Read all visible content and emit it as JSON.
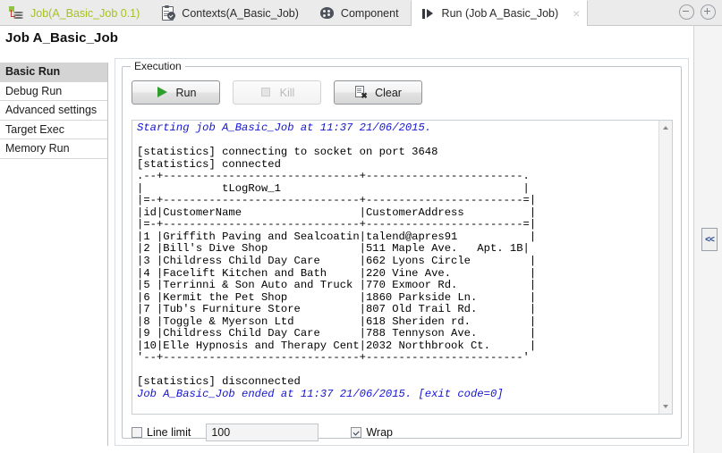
{
  "window": {
    "minimize_icon": "minimize-icon",
    "maximize_icon": "maximize-icon"
  },
  "tabs": [
    {
      "label": "Job(A_Basic_Job 0.1)",
      "icon": "job-icon",
      "active": false
    },
    {
      "label": "Contexts(A_Basic_Job)",
      "icon": "clipboard-check-icon",
      "active": false
    },
    {
      "label": "Component",
      "icon": "palette-icon",
      "active": false
    },
    {
      "label": "Run (Job A_Basic_Job)",
      "icon": "run-step-icon",
      "active": true,
      "close": "×"
    }
  ],
  "page_title": "Job A_Basic_Job",
  "sidebar": {
    "items": [
      {
        "label": "Basic Run",
        "selected": true
      },
      {
        "label": "Debug Run",
        "selected": false
      },
      {
        "label": "Advanced settings",
        "selected": false
      },
      {
        "label": "Target Exec",
        "selected": false
      },
      {
        "label": "Memory Run",
        "selected": false
      }
    ]
  },
  "execution": {
    "group_label": "Execution",
    "buttons": [
      {
        "label": "Run",
        "icon": "play-icon",
        "enabled": true
      },
      {
        "label": "Kill",
        "icon": "stop-icon",
        "enabled": false
      },
      {
        "label": "Clear",
        "icon": "clear-page-icon",
        "enabled": true
      }
    ]
  },
  "console": {
    "start_line": "Starting job A_Basic_Job at 11:37 21/06/2015.",
    "stats_connecting": "[statistics] connecting to socket on port 3648",
    "stats_connected": "[statistics] connected",
    "table_top": ".--+------------------------------+------------------------.",
    "table_title": "|            tLogRow_1                                     |",
    "table_sep1": "|=-+------------------------------+------------------------=|",
    "table_header": "|id|CustomerName                  |CustomerAddress          |",
    "table_sep2": "|=-+------------------------------+------------------------=|",
    "rows": [
      "|1 |Griffith Paving and Sealcoatin|talend@apres91           |",
      "|2 |Bill's Dive Shop              |511 Maple Ave.   Apt. 1B|",
      "|3 |Childress Child Day Care      |662 Lyons Circle         |",
      "|4 |Facelift Kitchen and Bath     |220 Vine Ave.            |",
      "|5 |Terrinni & Son Auto and Truck |770 Exmoor Rd.           |",
      "|6 |Kermit the Pet Shop           |1860 Parkside Ln.        |",
      "|7 |Tub's Furniture Store         |807 Old Trail Rd.        |",
      "|8 |Toggle & Myerson Ltd          |618 Sheriden rd.         |",
      "|9 |Childress Child Day Care      |788 Tennyson Ave.        |",
      "|10|Elle Hypnosis and Therapy Cent|2032 Northbrook Ct.      |"
    ],
    "table_bottom": "'--+------------------------------+------------------------'",
    "stats_disconnected": "[statistics] disconnected",
    "end_line": "Job A_Basic_Job ended at 11:37 21/06/2015. [exit code=0]",
    "table_data": {
      "columns": [
        "id",
        "CustomerName",
        "CustomerAddress"
      ],
      "title": "tLogRow_1",
      "records": [
        [
          "1",
          "Griffith Paving and Sealcoatin",
          "talend@apres91"
        ],
        [
          "2",
          "Bill's Dive Shop",
          "511 Maple Ave.   Apt. 1B"
        ],
        [
          "3",
          "Childress Child Day Care",
          "662 Lyons Circle"
        ],
        [
          "4",
          "Facelift Kitchen and Bath",
          "220 Vine Ave."
        ],
        [
          "5",
          "Terrinni & Son Auto and Truck",
          "770 Exmoor Rd."
        ],
        [
          "6",
          "Kermit the Pet Shop",
          "1860 Parkside Ln."
        ],
        [
          "7",
          "Tub's Furniture Store",
          "807 Old Trail Rd."
        ],
        [
          "8",
          "Toggle & Myerson Ltd",
          "618 Sheriden rd."
        ],
        [
          "9",
          "Childress Child Day Care",
          "788 Tennyson Ave."
        ],
        [
          "10",
          "Elle Hypnosis and Therapy Cent",
          "2032 Northbrook Ct."
        ]
      ]
    }
  },
  "footer": {
    "line_limit_label": "Line limit",
    "line_limit_checked": false,
    "line_limit_value": "100",
    "wrap_label": "Wrap",
    "wrap_checked": true
  },
  "collapse_button": {
    "label": "<<"
  },
  "colors": {
    "job_tab_text": "#a8c121",
    "console_highlight": "#1414d2",
    "play_green": "#2f9e2f",
    "selected_nav_bg": "#d4d4d4"
  }
}
